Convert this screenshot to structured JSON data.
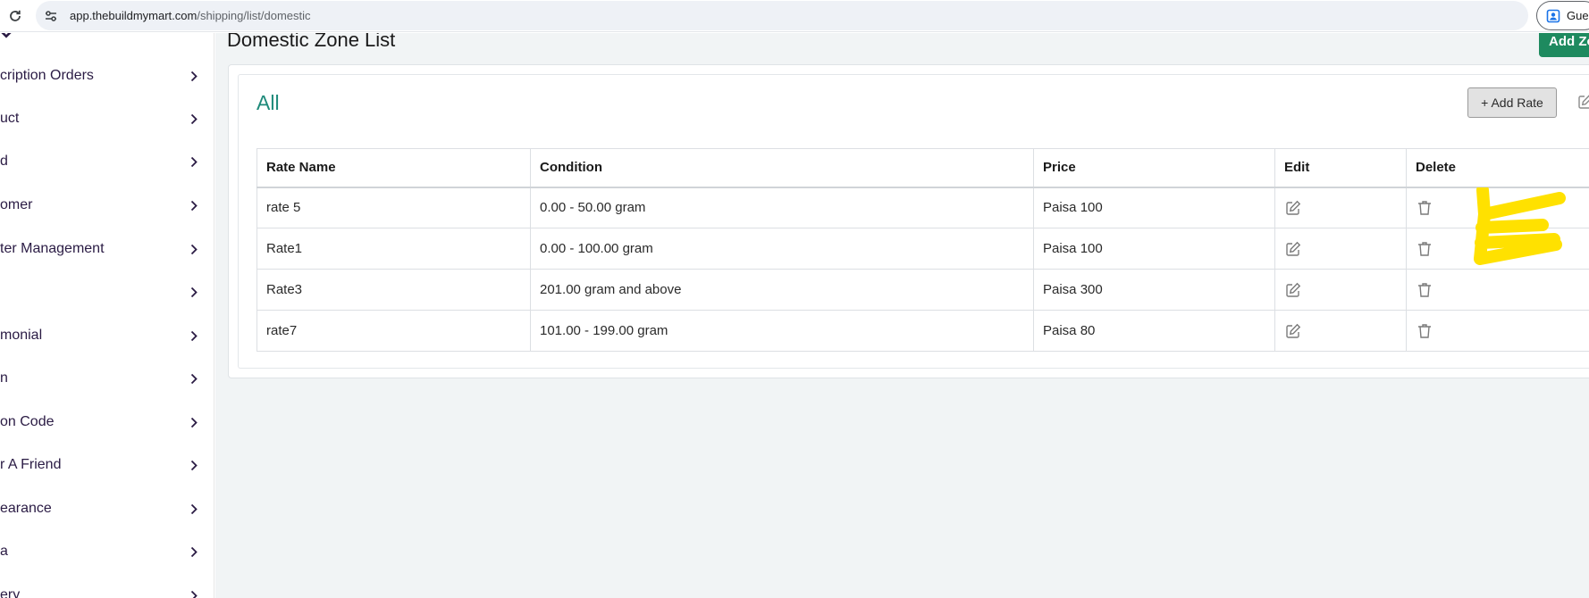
{
  "browser": {
    "url_host": "app.thebuildmymart.com",
    "url_path": "/shipping/list/domestic",
    "profile_label": "Gues",
    "icons": {
      "reload": "reload-icon",
      "site_info": "site-settings-icon",
      "profile": "profile-icon"
    }
  },
  "sidebar": {
    "items": [
      {
        "label": "cription Orders"
      },
      {
        "label": "uct"
      },
      {
        "label": "d"
      },
      {
        "label": "omer"
      },
      {
        "label": "ter Management"
      },
      {
        "label": ""
      },
      {
        "label": "monial"
      },
      {
        "label": "n"
      },
      {
        "label": "on Code"
      },
      {
        "label": "r A Friend"
      },
      {
        "label": "earance"
      },
      {
        "label": "a"
      },
      {
        "label": "ery"
      }
    ],
    "chevron_icon": "chevron-right-icon"
  },
  "main": {
    "page_title": "Domestic Zone List",
    "add_zone_label": "Add Zo",
    "group": {
      "title": "All",
      "add_rate_label": "+ Add Rate"
    },
    "table": {
      "headers": [
        "Rate Name",
        "Condition",
        "Price",
        "Edit",
        "Delete"
      ],
      "rows": [
        {
          "name": "rate 5",
          "condition": "0.00 - 50.00 gram",
          "price": "Paisa 100"
        },
        {
          "name": "Rate1",
          "condition": "0.00 - 100.00 gram",
          "price": "Paisa 100"
        },
        {
          "name": "Rate3",
          "condition": "201.00 gram and above",
          "price": "Paisa 300"
        },
        {
          "name": "rate7",
          "condition": "101.00 - 199.00 gram",
          "price": "Paisa 80"
        }
      ]
    }
  },
  "colors": {
    "accent_green": "#1e8a5f",
    "title_teal": "#1e8a7a",
    "annotation_yellow": "#ffe100"
  }
}
